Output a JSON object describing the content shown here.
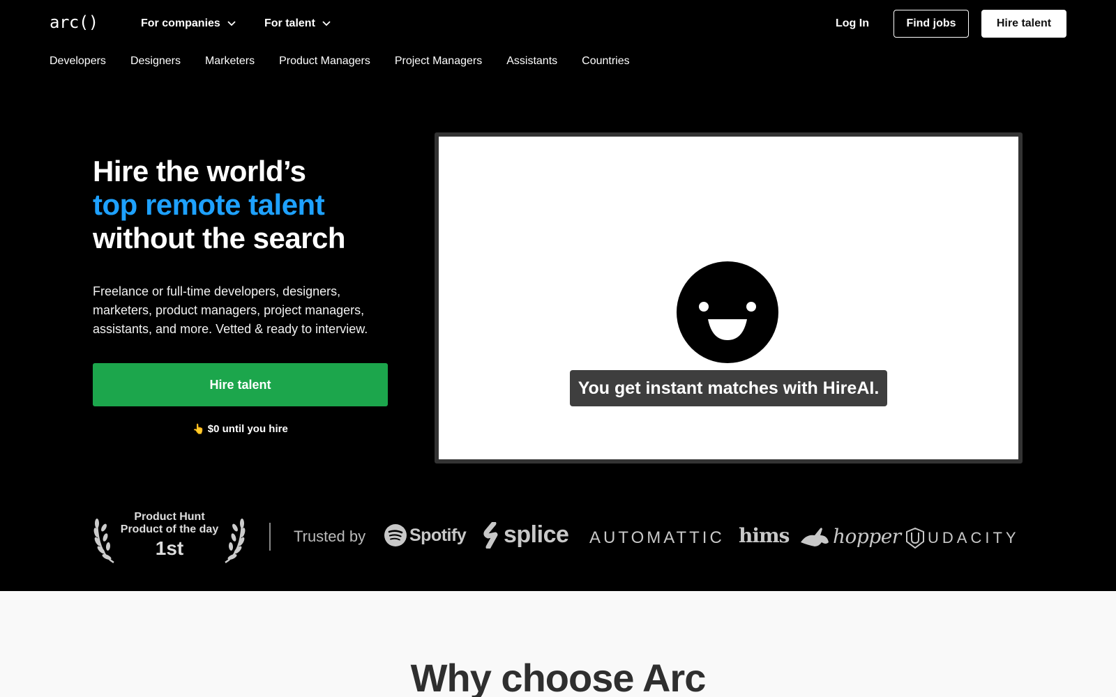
{
  "header": {
    "logo": "arc()",
    "nav_companies": "For companies",
    "nav_talent": "For talent",
    "login": "Log In",
    "find_jobs": "Find jobs",
    "hire_talent": "Hire talent"
  },
  "subnav": {
    "items": [
      "Developers",
      "Designers",
      "Marketers",
      "Product Managers",
      "Project Managers",
      "Assistants",
      "Countries"
    ]
  },
  "hero": {
    "title_line1": "Hire the world’s",
    "title_line2": "top remote talent",
    "title_line3": "without the search",
    "subtitle": "Freelance or full-time developers, designers, marketers, product managers, project managers, assistants, and more. Vetted & ready to interview.",
    "cta": "Hire talent",
    "note_emoji": "👆",
    "note": "$0 until you hire"
  },
  "video": {
    "caption": "You get instant matches with HireAI."
  },
  "award": {
    "line1": "Product Hunt",
    "line2": "Product of the day",
    "line3": "1st"
  },
  "trusted": {
    "label": "Trusted by",
    "brands": {
      "spotify": "Spotify",
      "splice": "splice",
      "automattic": "AUTOMATTIC",
      "hims": "hims",
      "hopper": "hopper",
      "udacity": "UDACITY"
    }
  },
  "section": {
    "why_title": "Why choose Arc"
  },
  "colors": {
    "accent_blue": "#1ea1ff",
    "cta_green": "#1ca64c",
    "background": "#000000"
  }
}
